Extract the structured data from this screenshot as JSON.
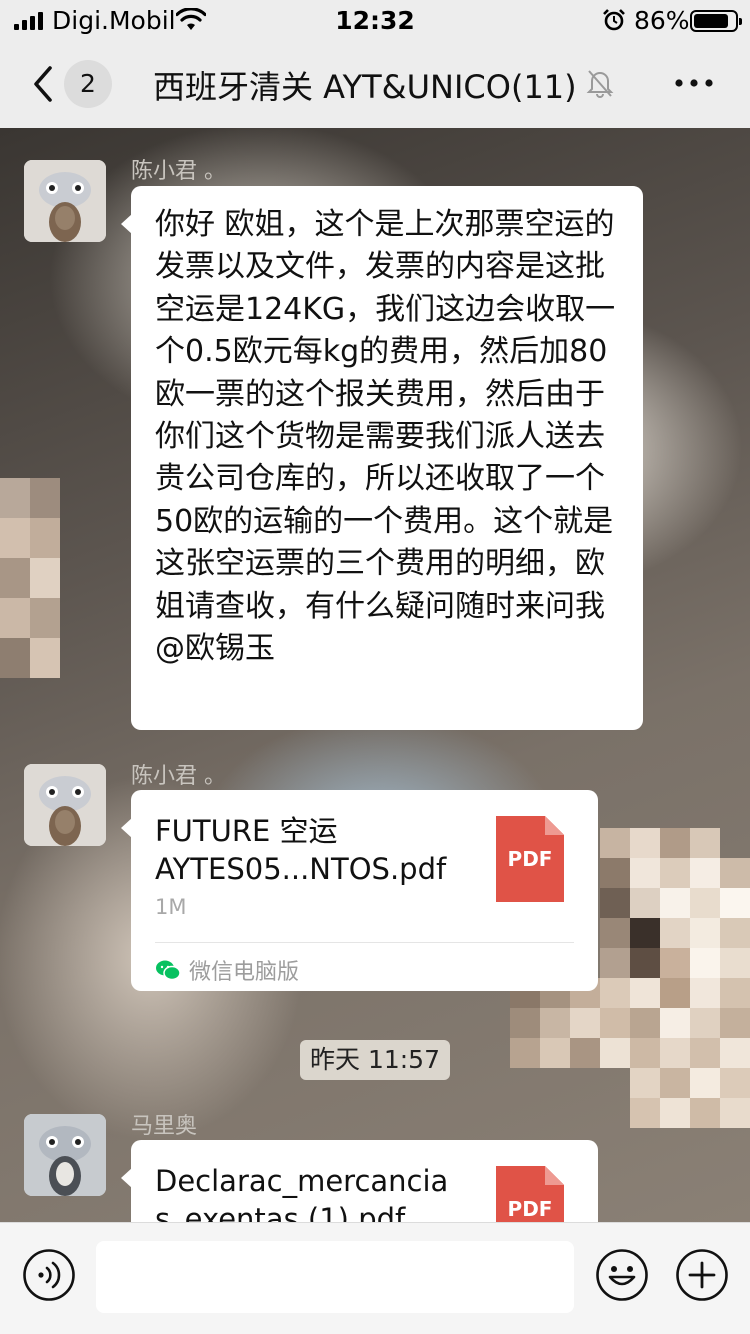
{
  "status_bar": {
    "carrier": "Digi.Mobil",
    "time": "12:32",
    "battery_percent": "86%",
    "battery_level": 0.86,
    "icons": [
      "signal-icon",
      "wifi-icon",
      "alarm-icon",
      "battery-icon"
    ]
  },
  "nav": {
    "unread_count": "2",
    "title": "西班牙清关 AYT&UNICO(11)",
    "icons": [
      "back-icon",
      "mute-bell-icon",
      "more-icon"
    ]
  },
  "messages": [
    {
      "sender": "陈小君 。",
      "type": "text",
      "text": "你好 欧姐，这个是上次那票空运的发票以及文件，发票的内容是这批空运是124KG，我们这边会收取一个0.5欧元每kg的费用，然后加80欧一票的这个报关费用，然后由于你们这个货物是需要我们派人送去贵公司仓库的，所以还收取了一个50欧的运输的一个费用。这个就是这张空运票的三个费用的明细，欧姐请查收，有什么疑问随时来问我@欧锡玉"
    },
    {
      "sender": "陈小君 。",
      "type": "file",
      "file_name": "FUTURE 空运\nAYTES05...NTOS.pdf",
      "file_size": "1M",
      "file_type": "PDF",
      "source": "微信电脑版"
    },
    {
      "timestamp": "昨天 11:57"
    },
    {
      "sender": "马里奥",
      "type": "file",
      "file_name": "Declarac_mercancia\ns_exentas (1).pdf",
      "file_type": "PDF"
    }
  ],
  "input_bar": {
    "placeholder": "",
    "icons": [
      "voice-icon",
      "emoji-icon",
      "plus-icon"
    ]
  },
  "colors": {
    "bar_bg": "#ededed",
    "bubble_bg": "#ffffff",
    "pdf_red": "#e05347",
    "wechat_green": "#07c160"
  }
}
